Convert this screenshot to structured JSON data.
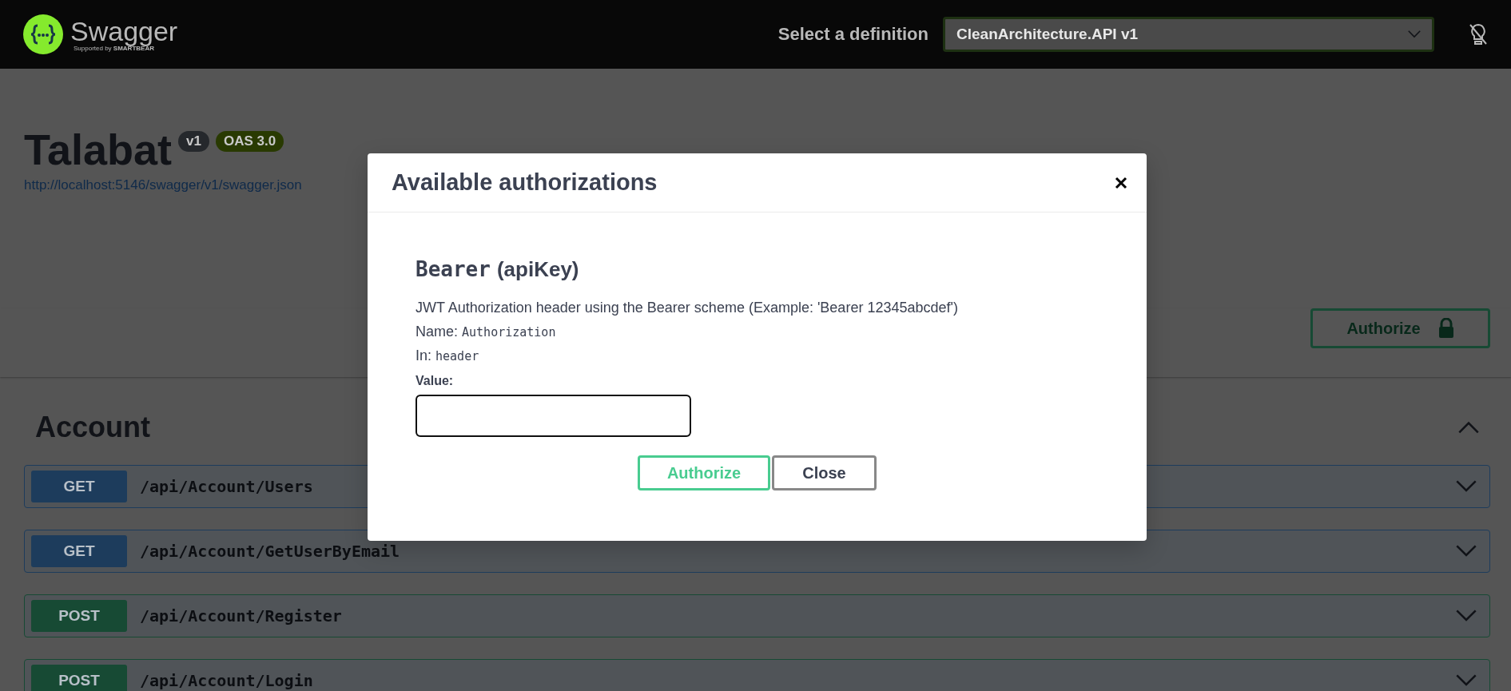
{
  "topbar": {
    "logo_text": "Swagger",
    "logo_caption": "Supported by",
    "logo_brand": "SMARTBEAR",
    "definition_label": "Select a definition",
    "definition_value": "CleanArchitecture.API v1"
  },
  "info": {
    "title": "Talabat",
    "badges": [
      "v1",
      "OAS 3.0"
    ],
    "link": "http://localhost:5146/swagger/v1/swagger.json"
  },
  "authorize_button": {
    "label": "Authorize"
  },
  "sections": [
    {
      "title": "Account",
      "expanded": true,
      "operations": [
        {
          "method": "GET",
          "path": "/api/Account/Users",
          "color": "#1d3c5c",
          "expanded": false
        },
        {
          "method": "GET",
          "path": "/api/Account/GetUserByEmail",
          "color": "#1d3c5c",
          "expanded": false
        },
        {
          "method": "POST",
          "path": "/api/Account/Register",
          "color": "#174a34",
          "expanded": false
        },
        {
          "method": "POST",
          "path": "/api/Account/Login",
          "color": "#174a34",
          "expanded": false
        }
      ]
    }
  ],
  "modal": {
    "title": "Available authorizations",
    "scheme": {
      "name": "Bearer",
      "type": "(apiKey)",
      "description": "JWT Authorization header using the Bearer scheme (Example: 'Bearer 12345abcdef')",
      "name_label": "Name:",
      "name_value": "Authorization",
      "in_label": "In:",
      "in_value": "header",
      "value_label": "Value:"
    },
    "buttons": [
      {
        "label": "Authorize",
        "kind": "primary"
      },
      {
        "label": "Close",
        "kind": "secondary"
      }
    ]
  }
}
